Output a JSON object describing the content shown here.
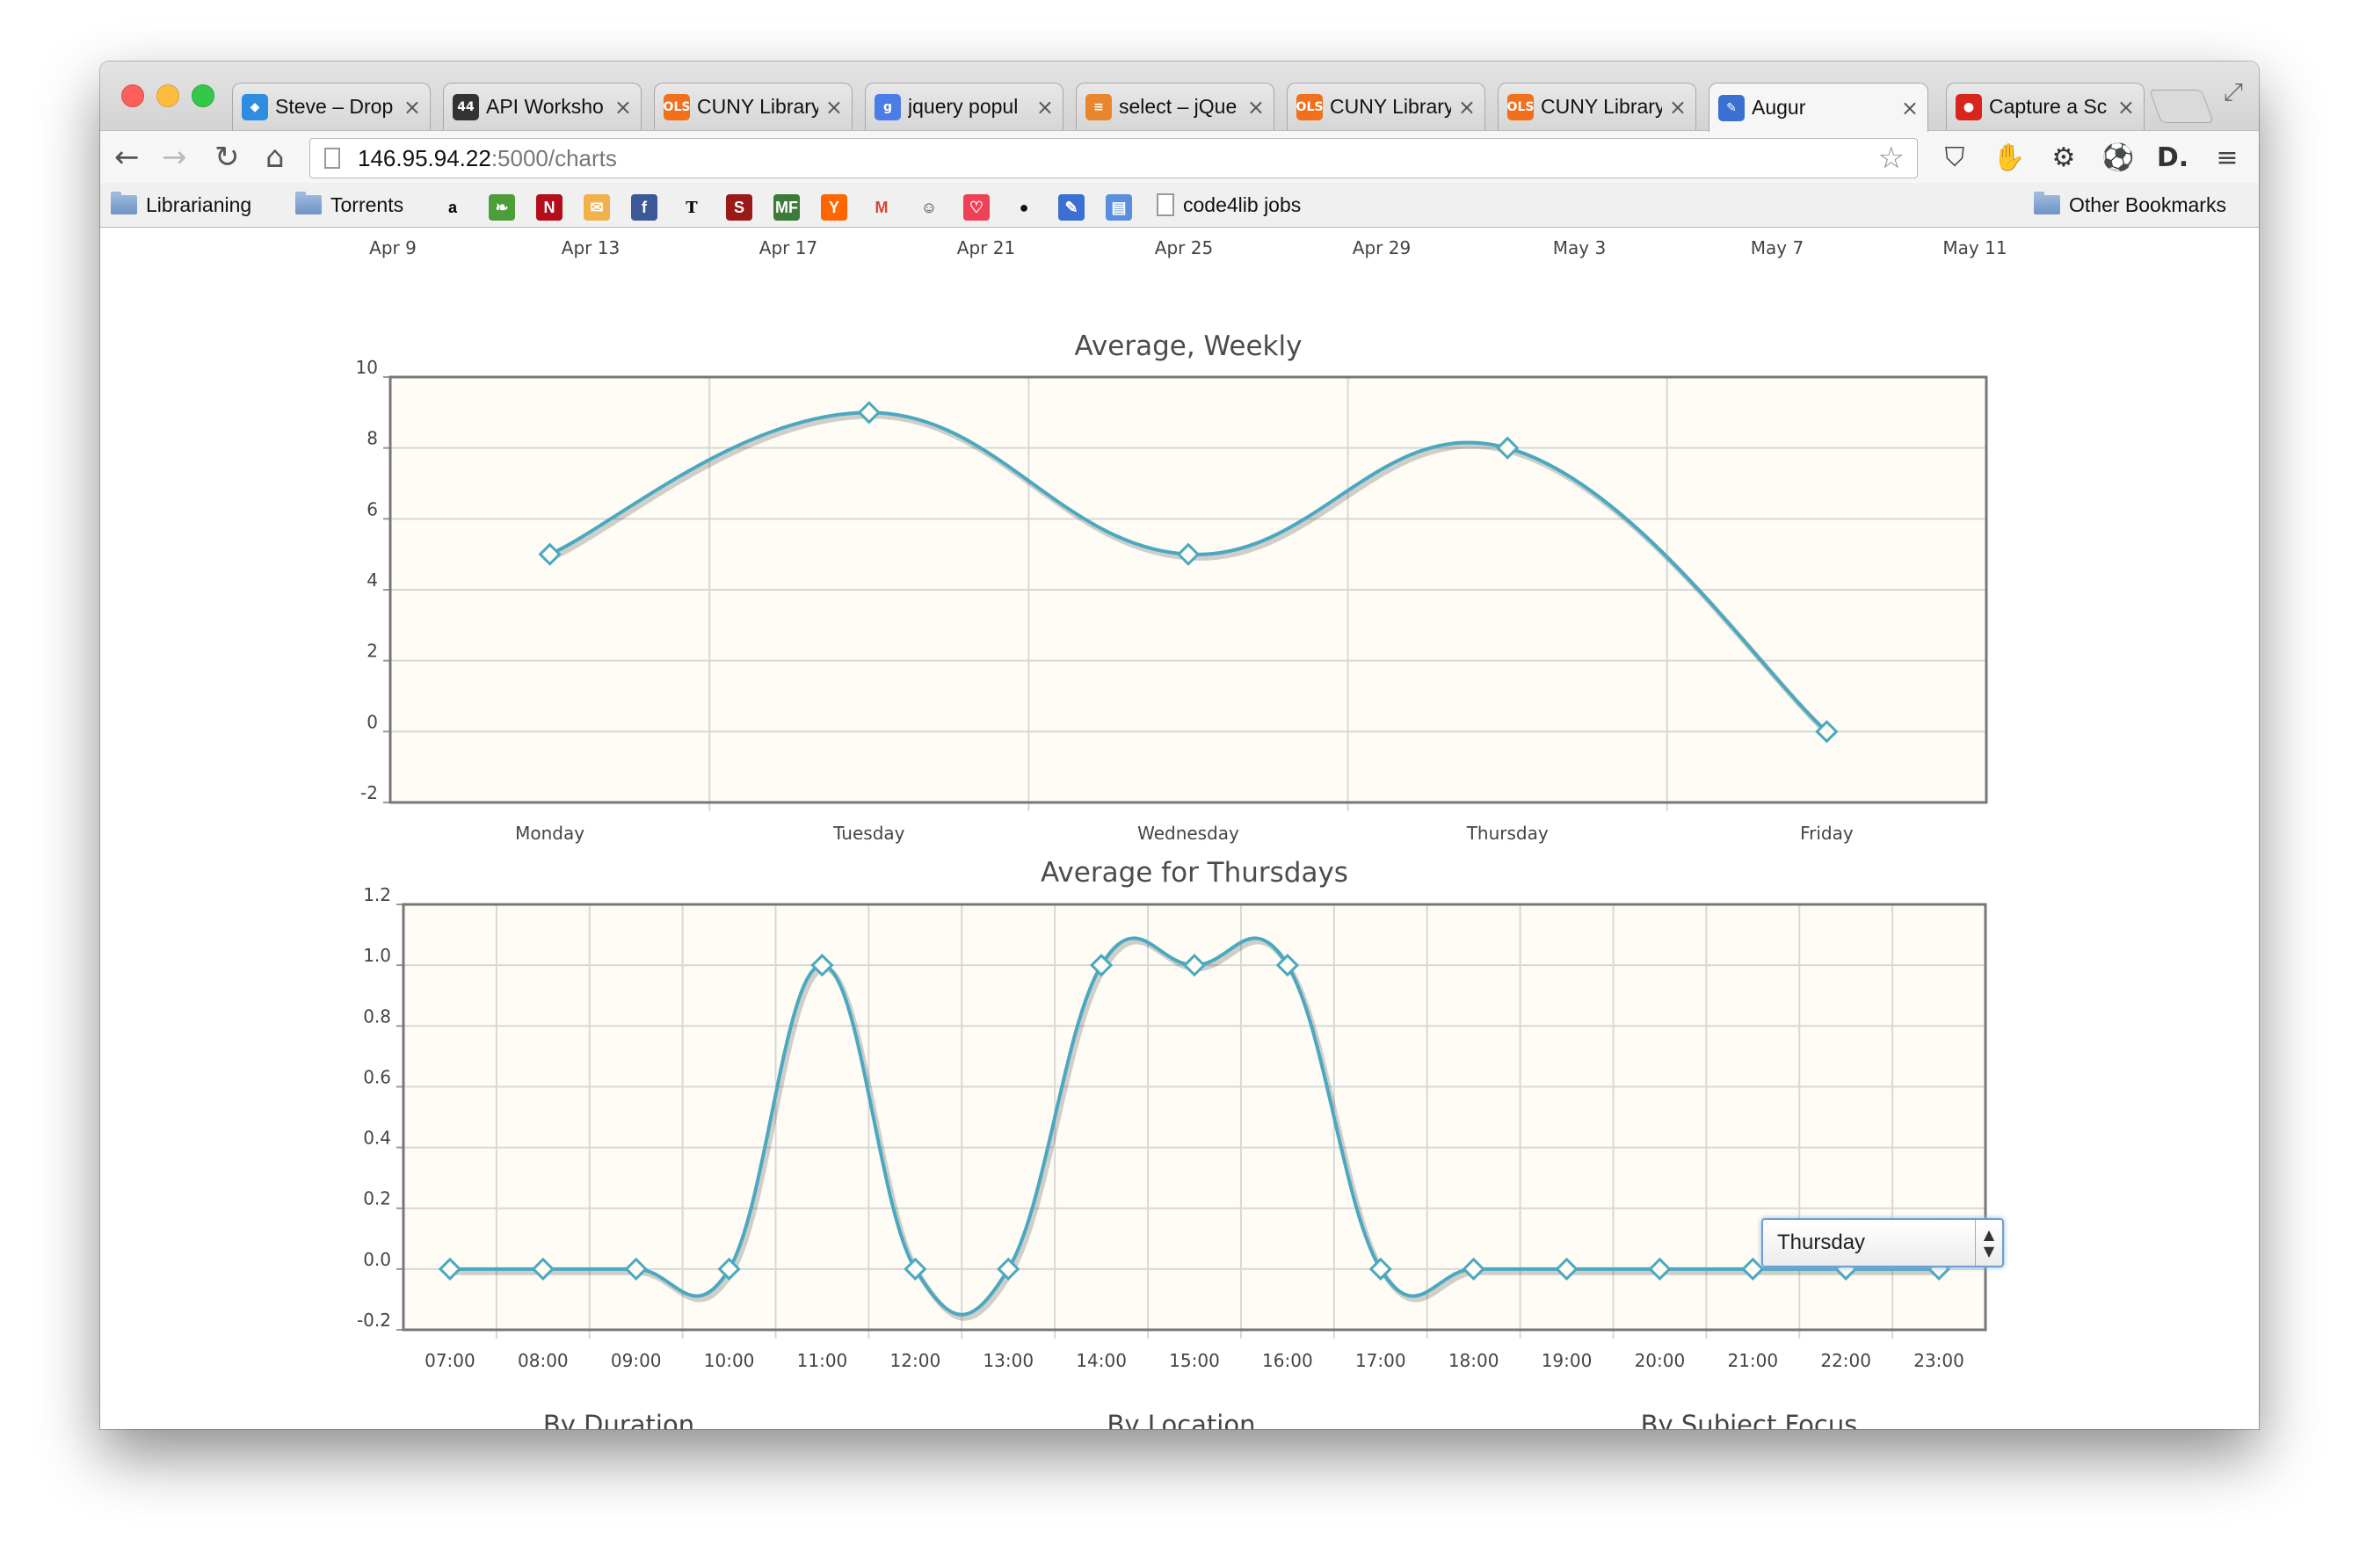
{
  "browser": {
    "tabs": [
      {
        "title": "Steve – Drop",
        "icon": "dropbox-icon",
        "color": "#2d8de0"
      },
      {
        "title": "API Worksho",
        "icon": "api-icon",
        "color": "#333333"
      },
      {
        "title": "CUNY Library",
        "icon": "ols-icon",
        "color": "#f26f1c"
      },
      {
        "title": "jquery popul",
        "icon": "google-icon",
        "color": "#4a7de6"
      },
      {
        "title": "select – jQue",
        "icon": "stackoverflow-icon",
        "color": "#e8862d"
      },
      {
        "title": "CUNY Library",
        "icon": "ols-icon",
        "color": "#f26f1c"
      },
      {
        "title": "CUNY Library",
        "icon": "ols-icon",
        "color": "#f26f1c"
      },
      {
        "title": "Augur",
        "icon": "augur-icon",
        "color": "#3b6fd1"
      },
      {
        "title": "Capture a Sc",
        "icon": "capture-icon",
        "color": "#d7261c"
      }
    ],
    "url_host": "146.95.94.22",
    "url_path": ":5000/charts",
    "bookmarks": {
      "librarianing": "Librarianing",
      "torrents": "Torrents",
      "code4lib": "code4lib jobs",
      "other": "Other Bookmarks"
    }
  },
  "timeline": {
    "labels": [
      "Apr 9",
      "Apr 13",
      "Apr 17",
      "Apr 21",
      "Apr 25",
      "Apr 29",
      "May 3",
      "May 7",
      "May 11"
    ]
  },
  "chart_data": [
    {
      "type": "line",
      "title": "Average, Weekly",
      "categories": [
        "Monday",
        "Tuesday",
        "Wednesday",
        "Thursday",
        "Friday"
      ],
      "values": [
        5,
        9,
        5,
        8,
        0
      ],
      "ylim": [
        -2,
        10
      ],
      "yticks": [
        "10",
        "8",
        "6",
        "4",
        "2",
        "0",
        "-2"
      ],
      "ytick_values": [
        10,
        8,
        6,
        4,
        2,
        0,
        -2
      ],
      "color": "#4aa8c0",
      "grid": true
    },
    {
      "type": "line",
      "title": "Average for Thursdays",
      "categories": [
        "07:00",
        "08:00",
        "09:00",
        "10:00",
        "11:00",
        "12:00",
        "13:00",
        "14:00",
        "15:00",
        "16:00",
        "17:00",
        "18:00",
        "19:00",
        "20:00",
        "21:00",
        "22:00",
        "23:00"
      ],
      "values": [
        0,
        0,
        0,
        0,
        1,
        0,
        0,
        1,
        1,
        1,
        0,
        0,
        0,
        0,
        0,
        0,
        0
      ],
      "ylim": [
        -0.2,
        1.2
      ],
      "yticks": [
        "1.2",
        "1.0",
        "0.8",
        "0.6",
        "0.4",
        "0.2",
        "0.0",
        "-0.2"
      ],
      "ytick_values": [
        1.2,
        1.0,
        0.8,
        0.6,
        0.4,
        0.2,
        0.0,
        -0.2
      ],
      "color": "#4aa8c0",
      "grid": true
    }
  ],
  "day_select": {
    "value": "Thursday"
  },
  "sections": [
    "By Duration",
    "By Location",
    "By Subject Focus"
  ]
}
